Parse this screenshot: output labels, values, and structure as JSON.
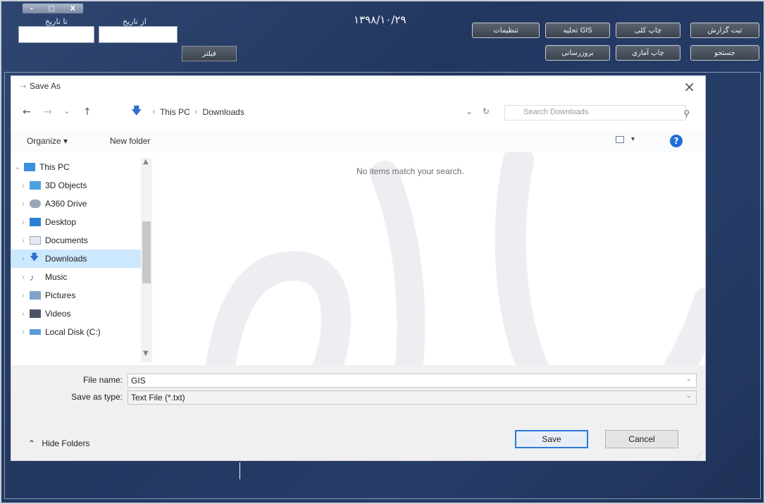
{
  "app": {
    "window_buttons": [
      "-",
      "□",
      "X"
    ],
    "to_date_label": "تا تاریخ",
    "from_date_label": "از تاریخ",
    "to_date_value": "",
    "from_date_value": "",
    "filter_label": "فیلتر",
    "header_date": "۱۳۹۸/۱۰/۲۹",
    "buttons_row1": [
      "تنظیمات",
      "تحلیه GIS",
      "چاپ کلی",
      "ثبت گزارش"
    ],
    "buttons_row2": [
      "بروزرسانی",
      "چاپ آماری",
      "جستجو"
    ]
  },
  "dialog": {
    "title": "Save As",
    "close_glyph": "×",
    "nav": {
      "back": "←",
      "forward": "→",
      "recent": "⌄",
      "up": "↑"
    },
    "breadcrumb": [
      "This PC",
      "Downloads"
    ],
    "search_placeholder": "Search Downloads",
    "toolbar": {
      "organize": "Organize ▾",
      "new_folder": "New folder",
      "help": "?"
    },
    "tree": [
      {
        "label": "This PC",
        "expanded": true,
        "icon": "computer-icon"
      },
      {
        "label": "3D Objects",
        "icon": "3d-objects-icon"
      },
      {
        "label": "A360 Drive",
        "icon": "cloud-drive-icon"
      },
      {
        "label": "Desktop",
        "icon": "desktop-icon"
      },
      {
        "label": "Documents",
        "icon": "documents-icon"
      },
      {
        "label": "Downloads",
        "icon": "downloads-icon",
        "selected": true
      },
      {
        "label": "Music",
        "icon": "music-icon"
      },
      {
        "label": "Pictures",
        "icon": "pictures-icon"
      },
      {
        "label": "Videos",
        "icon": "videos-icon"
      },
      {
        "label": "Local Disk (C:)",
        "icon": "local-disk-icon"
      }
    ],
    "empty_message": "No items match your search.",
    "file_name_label": "File name:",
    "file_name_value": "GIS",
    "save_as_type_label": "Save as type:",
    "save_as_type_value": "Text File (*.txt)",
    "hide_folders": "Hide Folders",
    "save_label": "Save",
    "cancel_label": "Cancel"
  },
  "colors": {
    "app_background": "#243860",
    "selection": "#cce8ff",
    "accent_blue": "#2a7ad9"
  }
}
